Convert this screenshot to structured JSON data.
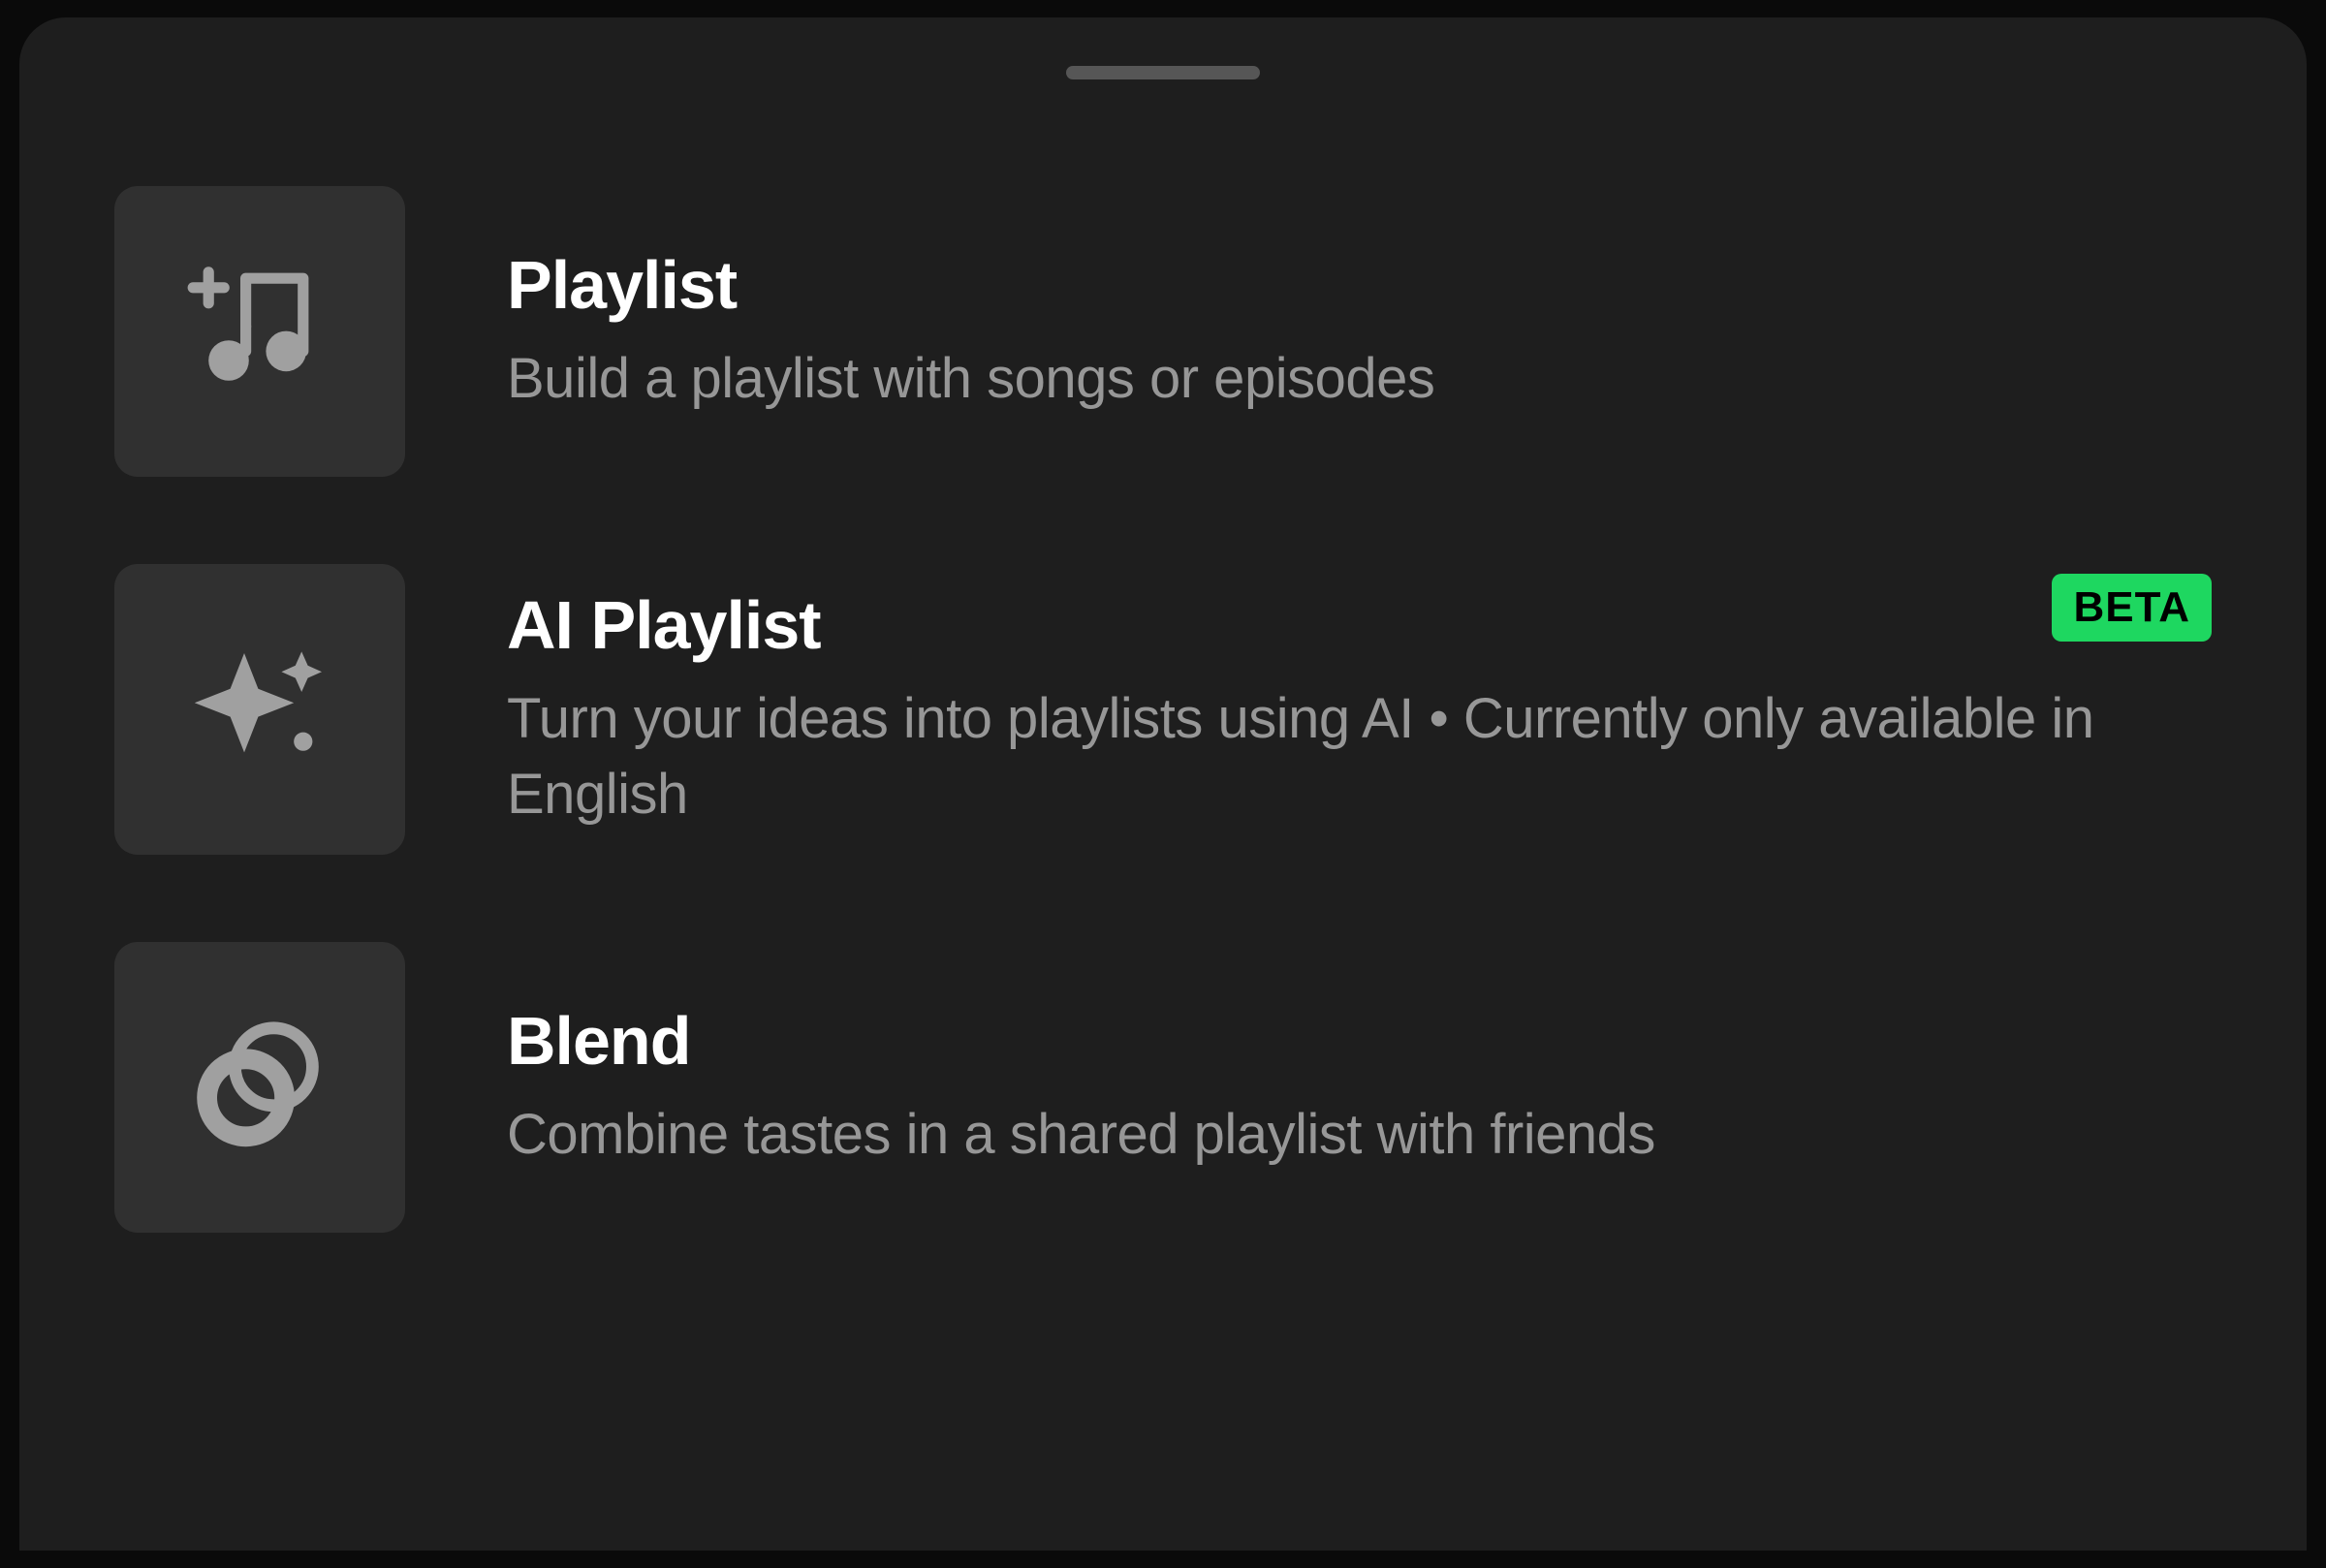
{
  "menu": {
    "items": [
      {
        "title": "Playlist",
        "description": "Build a playlist with songs or episodes",
        "icon": "music-add-icon",
        "badge": null
      },
      {
        "title": "AI Playlist",
        "description": "Turn your ideas into playlists using AI • Currently only available in English",
        "icon": "sparkle-icon",
        "badge": "BETA"
      },
      {
        "title": "Blend",
        "description": "Combine tastes in a shared playlist with friends",
        "icon": "blend-icon",
        "badge": null
      }
    ]
  },
  "colors": {
    "accent": "#1ed760",
    "background": "#1e1e1e",
    "iconBox": "#303030",
    "textPrimary": "#ffffff",
    "textSecondary": "#979797"
  }
}
